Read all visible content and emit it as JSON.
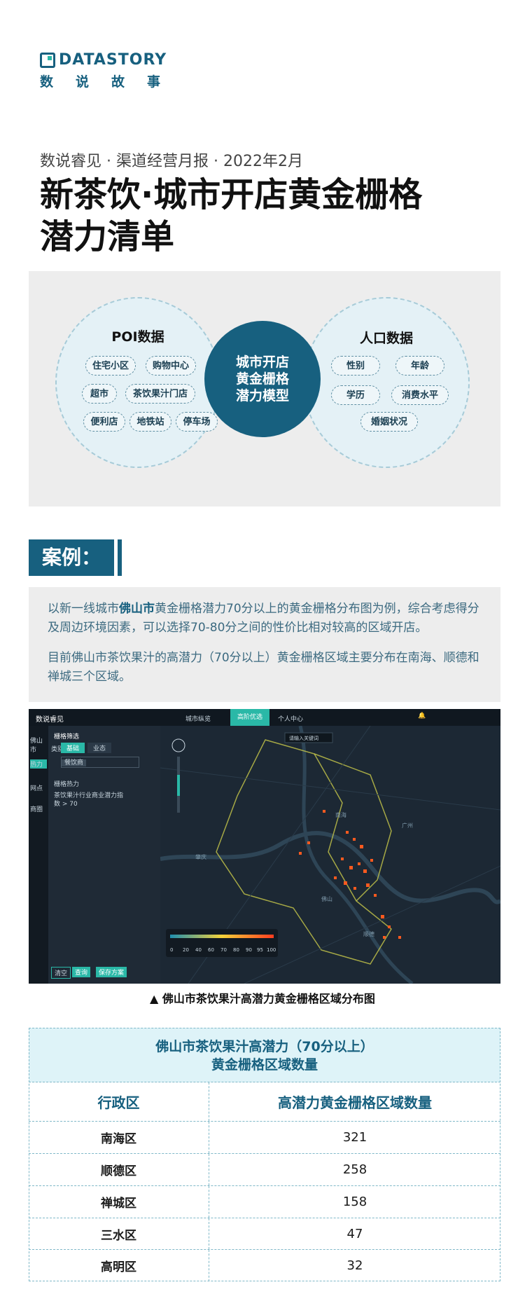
{
  "brand": {
    "name_en": "DATASTORY",
    "name_cn": "数说故事"
  },
  "header": {
    "subtitle": "数说睿见 · 渠道经营月报 · 2022年2月",
    "title_line1": "新茶饮·城市开店黄金栅格",
    "title_line2": "潜力清单"
  },
  "model": {
    "left_title": "POI数据",
    "left_items": [
      "住宅小区",
      "购物中心",
      "超市",
      "茶饮果汁门店",
      "便利店",
      "地铁站",
      "停车场"
    ],
    "center_line1": "城市开店",
    "center_line2": "黄金栅格",
    "center_line3": "潜力模型",
    "right_title": "人口数据",
    "right_items": [
      "性别",
      "年龄",
      "学历",
      "消费水平",
      "婚姻状况"
    ]
  },
  "case": {
    "label": "案例：",
    "p1_a": "以新一线城市",
    "p1_b": "佛山市",
    "p1_c": "黄金栅格潜力70分以上的黄金栅格分布图为例，综合考虑得分及周边环境因素，可以选择70-80分之间的性价比相对较高的区域开店。",
    "p2": "目前佛山市茶饮果汁的高潜力（70分以上）黄金栅格区域主要分布在南海、顺德和禅城三个区域。"
  },
  "map": {
    "app_name": "数说睿见",
    "nav": [
      "城市纵览",
      "高阶优选",
      "个人中心"
    ],
    "side": [
      "佛山市",
      "热力",
      "网点",
      "商圈"
    ],
    "panel_title": "栅格筛选",
    "tabs": [
      "基础",
      "业态"
    ],
    "tab_prefix": "类别",
    "tag": "餐饮商",
    "section": "栅格热力",
    "rule": "茶饮果汁行业商业潜力指数 > 70",
    "buttons": [
      "清空",
      "查询",
      "保存方案"
    ],
    "search_placeholder": "请输入关键词",
    "legend_ticks": [
      "0",
      "20",
      "40",
      "60",
      "70",
      "80",
      "90",
      "95",
      "100"
    ],
    "labels": [
      "广州",
      "佛山",
      "肇庆",
      "顺德",
      "南海"
    ]
  },
  "caption": "▲ 佛山市茶饮果汁高潜力黄金栅格区域分布图",
  "table": {
    "title_line1": "佛山市茶饮果汁高潜力（70分以上）",
    "title_line2": "黄金栅格区域数量",
    "col1": "行政区",
    "col2": "高潜力黄金栅格区域数量",
    "rows": [
      {
        "district": "南海区",
        "count": "321"
      },
      {
        "district": "顺德区",
        "count": "258"
      },
      {
        "district": "禅城区",
        "count": "158"
      },
      {
        "district": "三水区",
        "count": "47"
      },
      {
        "district": "高明区",
        "count": "32"
      }
    ]
  },
  "colors": {
    "brand": "#17607f",
    "accent": "#2ab8a7",
    "panel": "#ededed"
  }
}
